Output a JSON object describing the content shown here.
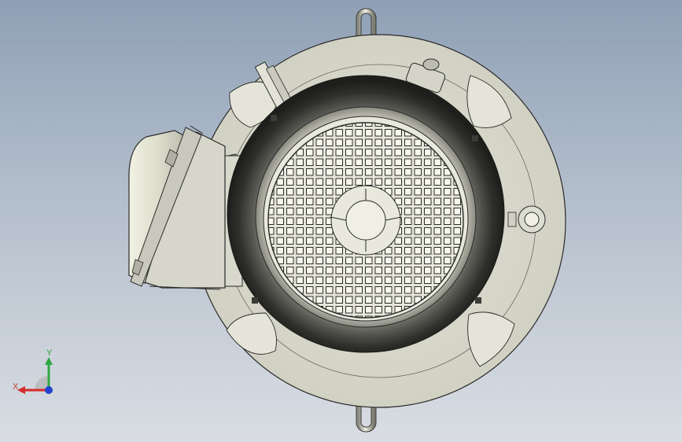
{
  "viewport": {
    "background_top": "#8fa0b6",
    "background_bottom": "#d9dde3"
  },
  "model": {
    "body_color": "#d8d8cc",
    "shade_color": "#3a3a36",
    "edge_color": "#2a2a2a"
  },
  "triad": {
    "x_label": "X",
    "y_label": "Y",
    "x_color": "#d42a2a",
    "y_color": "#2ea843",
    "z_color": "#2244cc"
  }
}
